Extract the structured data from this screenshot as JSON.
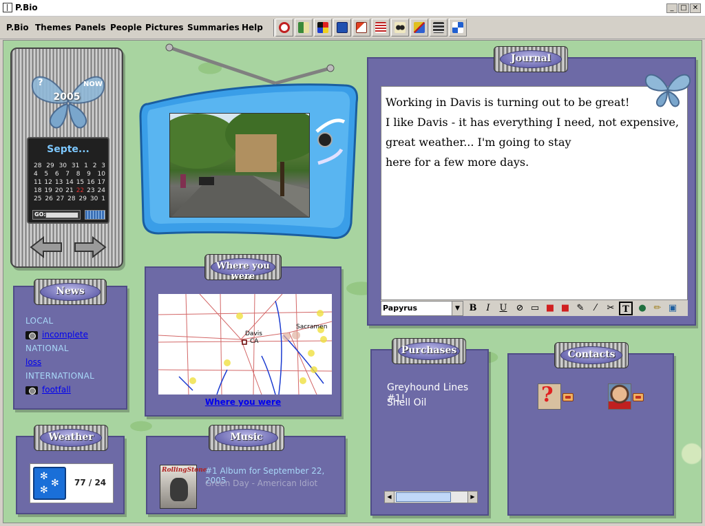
{
  "window": {
    "title": "P.Bio"
  },
  "menu": [
    "P.Bio",
    "Themes",
    "Panels",
    "People",
    "Pictures",
    "Summaries",
    "Help"
  ],
  "toolbar_icons": [
    "refresh-icon",
    "book-map-icon",
    "color-blocks-icon",
    "save-icon",
    "windows-icon",
    "list-icon",
    "footprints-icon",
    "chart-icon",
    "layout-icon",
    "panels-icon"
  ],
  "calendar": {
    "year": "2005",
    "help": "?",
    "now": "NOW",
    "month": "Septe...",
    "go_label": "GO:",
    "weeks": [
      [
        "28",
        "29",
        "30",
        "31",
        "1",
        "2",
        "3"
      ],
      [
        "4",
        "5",
        "6",
        "7",
        "8",
        "9",
        "10"
      ],
      [
        "11",
        "12",
        "13",
        "14",
        "15",
        "16",
        "17"
      ],
      [
        "18",
        "19",
        "20",
        "21",
        "22",
        "23",
        "24"
      ],
      [
        "25",
        "26",
        "27",
        "28",
        "29",
        "30",
        "1"
      ]
    ],
    "today": "22"
  },
  "journal": {
    "label": "Journal",
    "lines": [
      "Working in Davis is turning out to be great!",
      "I like Davis - it has everything I need, not expensive,",
      "great weather...  I'm going to stay",
      "here for a few more days."
    ],
    "font": "Papyrus",
    "format_buttons": [
      "B",
      "I",
      "U"
    ]
  },
  "news": {
    "label": "News",
    "local": "LOCAL",
    "local_link": "incomplete",
    "national": "NATIONAL",
    "national_link": "loss",
    "international": "INTERNATIONAL",
    "international_link": "footfall"
  },
  "map": {
    "label": "Where you were",
    "link": "Where you were",
    "city1": "Davis",
    "city1_state": "CA",
    "city2": "Sacramen"
  },
  "purchases": {
    "label": "Purchases",
    "items": [
      "Greyhound Lines #1!",
      "Shell Oil"
    ]
  },
  "contacts": {
    "label": "Contacts"
  },
  "weather": {
    "label": "Weather",
    "temp": "77 / 24"
  },
  "music": {
    "label": "Music",
    "title": "#1 Album for September 22, 2005",
    "artist": "Green Day - American Idiot",
    "cover_text": "RollingStone"
  },
  "colors": {
    "panel": "#6d6aa6",
    "background": "#a8d4a0",
    "link": "#0000ee",
    "news_text": "#a8d8f8"
  }
}
